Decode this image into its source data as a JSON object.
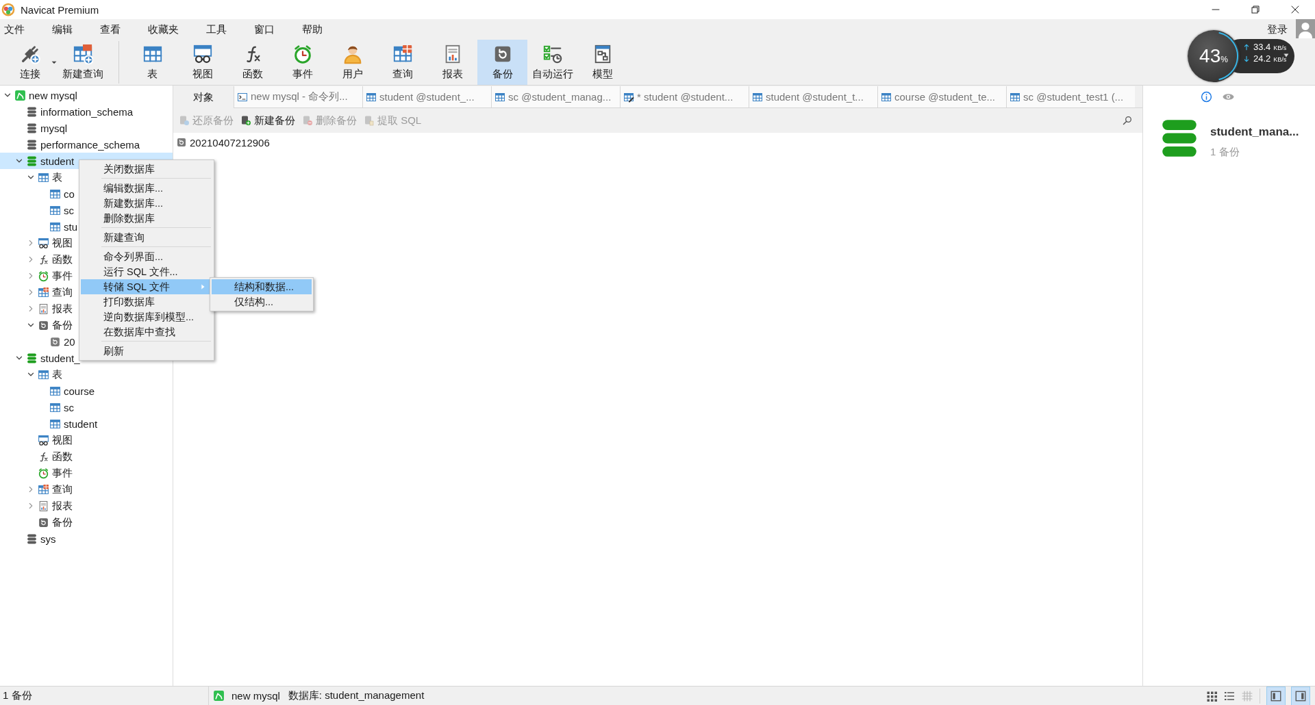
{
  "window": {
    "title": "Navicat Premium"
  },
  "menu": [
    "文件",
    "编辑",
    "查看",
    "收藏夹",
    "工具",
    "窗口",
    "帮助"
  ],
  "login": "登录",
  "toolbar": [
    {
      "kind": "connect",
      "label": "连接",
      "selected": false
    },
    {
      "kind": "new-query",
      "label": "新建查询",
      "selected": false
    },
    {
      "kind": "table",
      "label": "表",
      "selected": false
    },
    {
      "kind": "view",
      "label": "视图",
      "selected": false
    },
    {
      "kind": "function",
      "label": "函数",
      "selected": false
    },
    {
      "kind": "event",
      "label": "事件",
      "selected": false
    },
    {
      "kind": "user",
      "label": "用户",
      "selected": false
    },
    {
      "kind": "query",
      "label": "查询",
      "selected": false
    },
    {
      "kind": "report",
      "label": "报表",
      "selected": false
    },
    {
      "kind": "backup",
      "label": "备份",
      "selected": true
    },
    {
      "kind": "autorun",
      "label": "自动运行",
      "selected": false
    },
    {
      "kind": "model",
      "label": "模型",
      "selected": false
    }
  ],
  "net_monitor": {
    "percent": "43",
    "percent_unit": "%",
    "upload": "33.4",
    "upload_unit": "KB/s",
    "download": "24.2",
    "download_unit": "KB/s"
  },
  "tree": [
    {
      "kind": "connection",
      "label": "new mysql",
      "expanded": true,
      "selected": false,
      "children": [
        {
          "kind": "database",
          "label": "information_schema",
          "open": false,
          "selected": false
        },
        {
          "kind": "database",
          "label": "mysql",
          "open": false,
          "selected": false
        },
        {
          "kind": "database",
          "label": "performance_schema",
          "open": false,
          "selected": false
        },
        {
          "kind": "database",
          "label": "student",
          "open": true,
          "expanded": true,
          "selected": true,
          "children": [
            {
              "kind": "tables",
              "label": "表",
              "expanded": true,
              "selected": false,
              "children": [
                {
                  "kind": "table",
                  "label": "co",
                  "selected": false
                },
                {
                  "kind": "table",
                  "label": "sc",
                  "selected": false
                },
                {
                  "kind": "table",
                  "label": "stu",
                  "selected": false
                }
              ]
            },
            {
              "kind": "views",
              "label": "视图",
              "expanded": false,
              "selected": false
            },
            {
              "kind": "functions",
              "label": "函数",
              "expanded": false,
              "selected": false
            },
            {
              "kind": "events",
              "label": "事件",
              "expanded": false,
              "selected": false
            },
            {
              "kind": "queries",
              "label": "查询",
              "expanded": false,
              "selected": false
            },
            {
              "kind": "reports",
              "label": "报表",
              "expanded": false,
              "selected": false
            },
            {
              "kind": "backups",
              "label": "备份",
              "expanded": true,
              "selected": false,
              "children": [
                {
                  "kind": "backup",
                  "label": "20",
                  "selected": false
                }
              ]
            }
          ]
        },
        {
          "kind": "database",
          "label": "student_",
          "open": true,
          "expanded": true,
          "selected": false,
          "children": [
            {
              "kind": "tables",
              "label": "表",
              "expanded": true,
              "selected": false,
              "children": [
                {
                  "kind": "table",
                  "label": "course",
                  "selected": false
                },
                {
                  "kind": "table",
                  "label": "sc",
                  "selected": false
                },
                {
                  "kind": "table",
                  "label": "student",
                  "selected": false
                }
              ]
            },
            {
              "kind": "views",
              "label": "视图",
              "selected": false
            },
            {
              "kind": "functions",
              "label": "函数",
              "selected": false
            },
            {
              "kind": "events",
              "label": "事件",
              "selected": false
            },
            {
              "kind": "queries",
              "label": "查询",
              "expanded": false,
              "selected": false
            },
            {
              "kind": "reports",
              "label": "报表",
              "expanded": false,
              "selected": false
            },
            {
              "kind": "backups",
              "label": "备份",
              "selected": false
            }
          ]
        },
        {
          "kind": "database",
          "label": "sys",
          "open": false,
          "selected": false
        }
      ]
    }
  ],
  "context_menu": {
    "groups": [
      [
        {
          "kind": "command",
          "label": "关闭数据库",
          "selected": false
        }
      ],
      [
        {
          "kind": "command",
          "label": "编辑数据库...",
          "selected": false
        },
        {
          "kind": "command",
          "label": "新建数据库...",
          "selected": false
        },
        {
          "kind": "command",
          "label": "删除数据库",
          "selected": false
        }
      ],
      [
        {
          "kind": "command",
          "label": "新建查询",
          "selected": false
        }
      ],
      [
        {
          "kind": "command",
          "label": "命令列界面...",
          "selected": false
        },
        {
          "kind": "command",
          "label": "运行 SQL 文件...",
          "selected": false
        },
        {
          "kind": "submenu",
          "label": "转储 SQL 文件",
          "selected": true
        },
        {
          "kind": "command",
          "label": "打印数据库",
          "selected": false
        },
        {
          "kind": "command",
          "label": "逆向数据库到模型...",
          "selected": false
        },
        {
          "kind": "command",
          "label": "在数据库中查找",
          "selected": false
        }
      ],
      [
        {
          "kind": "command",
          "label": "刷新",
          "selected": false
        }
      ]
    ],
    "submenu": [
      {
        "label": "结构和数据...",
        "selected": true
      },
      {
        "label": "仅结构...",
        "selected": false
      }
    ]
  },
  "tabs": [
    {
      "kind": "objects",
      "label": "对象",
      "selected": true
    },
    {
      "kind": "console",
      "label": "new mysql - 命令列...",
      "selected": false
    },
    {
      "kind": "table",
      "label": "student @student_...",
      "selected": false
    },
    {
      "kind": "table",
      "label": "sc @student_manag...",
      "selected": false
    },
    {
      "kind": "table-edit",
      "label": "* student @student...",
      "selected": false
    },
    {
      "kind": "table",
      "label": "student @student_t...",
      "selected": false
    },
    {
      "kind": "table",
      "label": "course @student_te...",
      "selected": false
    },
    {
      "kind": "table",
      "label": "sc @student_test1 (...",
      "selected": false
    }
  ],
  "object_toolbar": [
    {
      "kind": "restore",
      "label": "还原备份",
      "disabled": true
    },
    {
      "kind": "create",
      "label": "新建备份",
      "disabled": false
    },
    {
      "kind": "delete",
      "label": "删除备份",
      "disabled": true
    },
    {
      "kind": "extract",
      "label": "提取 SQL",
      "disabled": true
    }
  ],
  "objects": [
    {
      "label": "20210407212906"
    }
  ],
  "info_panel": {
    "tabs": [
      {
        "kind": "info",
        "selected": true
      },
      {
        "kind": "preview",
        "selected": false
      }
    ],
    "title": "student_mana...",
    "subtitle": "1 备份"
  },
  "status_bar": {
    "count": "1 备份",
    "connection": "new mysql",
    "database": "数据库: student_management",
    "views": [
      {
        "kind": "grid",
        "disabled": false
      },
      {
        "kind": "list",
        "disabled": false
      },
      {
        "kind": "detail",
        "disabled": true
      }
    ],
    "panels": [
      {
        "kind": "left",
        "on": true
      },
      {
        "kind": "right",
        "on": true
      }
    ]
  }
}
